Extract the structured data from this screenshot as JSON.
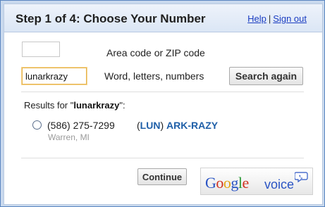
{
  "header": {
    "title": "Step 1 of 4: Choose Your Number",
    "help_label": "Help",
    "separator": "|",
    "signout_label": "Sign out"
  },
  "form": {
    "area_code_value": "",
    "area_code_label": "Area code or ZIP code",
    "word_value": "lunarkrazy",
    "word_label": "Word, letters, numbers",
    "search_button_label": "Search again"
  },
  "results": {
    "prefix": "Results for \"",
    "query": "lunarkrazy",
    "suffix": "\":",
    "items": [
      {
        "number": "(586) 275-7299",
        "word_open": "(",
        "word_part1": "LUN",
        "word_mid": ") ",
        "word_part2": "ARK-RAZY",
        "location": "Warren, MI",
        "selected": false
      }
    ]
  },
  "footer": {
    "continue_label": "Continue",
    "logo": {
      "letters": [
        "G",
        "o",
        "o",
        "g",
        "l",
        "e"
      ],
      "product": "voice",
      "icon": "phone-speech-bubble-icon"
    }
  },
  "colors": {
    "accent_blue": "#1f5fa8",
    "link_blue": "#1a3dc1",
    "frame_border": "#5a86c0",
    "input_focus": "#e6b24b"
  }
}
